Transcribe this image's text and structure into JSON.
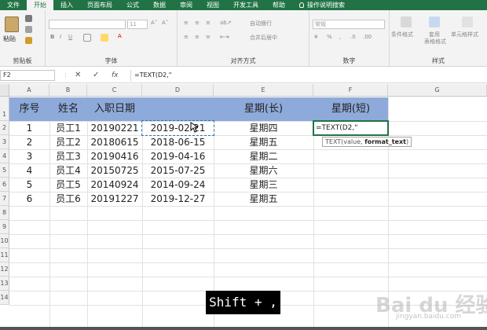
{
  "tabs": [
    "文件",
    "开始",
    "插入",
    "页面布局",
    "公式",
    "数据",
    "审阅",
    "视图",
    "开发工具",
    "帮助",
    "操作说明搜索"
  ],
  "active_tab": "开始",
  "ribbon": {
    "paste_label": "粘贴",
    "font_size": "11",
    "wrap_text": "自动换行",
    "merge_center": "合并后居中",
    "number_format": "常规",
    "cond_format": "条件格式",
    "table_format_1": "套用",
    "table_format_2": "表格格式",
    "cell_style": "单元格样式",
    "groups": {
      "clipboard": "剪贴板",
      "font": "字体",
      "alignment": "对齐方式",
      "number": "数字",
      "styles": "样式"
    }
  },
  "formula_bar": {
    "name_box": "F2",
    "cancel": "✕",
    "enter": "✓",
    "fx": "fx",
    "formula": "=TEXT(D2,\""
  },
  "columns": [
    "A",
    "B",
    "C",
    "D",
    "E",
    "F",
    "G"
  ],
  "rows": [
    "1",
    "2",
    "3",
    "4",
    "5",
    "6",
    "7",
    "8",
    "9",
    "10",
    "11",
    "12",
    "13",
    "14"
  ],
  "headers": {
    "a": "序号",
    "b": "姓名",
    "c": "入职日期",
    "e": "星期(长)",
    "f": "星期(短)"
  },
  "data_rows": [
    {
      "a": "1",
      "b": "员工1",
      "c": "20190221",
      "d": "2019-02-21",
      "e": "星期四"
    },
    {
      "a": "2",
      "b": "员工2",
      "c": "20180615",
      "d": "2018-06-15",
      "e": "星期五"
    },
    {
      "a": "3",
      "b": "员工3",
      "c": "20190416",
      "d": "2019-04-16",
      "e": "星期二"
    },
    {
      "a": "4",
      "b": "员工4",
      "c": "20150725",
      "d": "2015-07-25",
      "e": "星期六"
    },
    {
      "a": "5",
      "b": "员工5",
      "c": "20140924",
      "d": "2014-09-24",
      "e": "星期三"
    },
    {
      "a": "6",
      "b": "员工6",
      "c": "20191227",
      "d": "2019-12-27",
      "e": "星期五"
    }
  ],
  "editing_cell": "=TEXT(D2,\"",
  "tooltip": {
    "prefix": "TEXT(value, ",
    "bold": "format_text",
    "suffix": ")"
  },
  "keystroke": "Shift + ,",
  "watermark": {
    "main": "Bai du 经验",
    "sub": "jingyan.baidu.com"
  },
  "colors": {
    "excel_green": "#217346",
    "header_band": "#8eaadb"
  }
}
